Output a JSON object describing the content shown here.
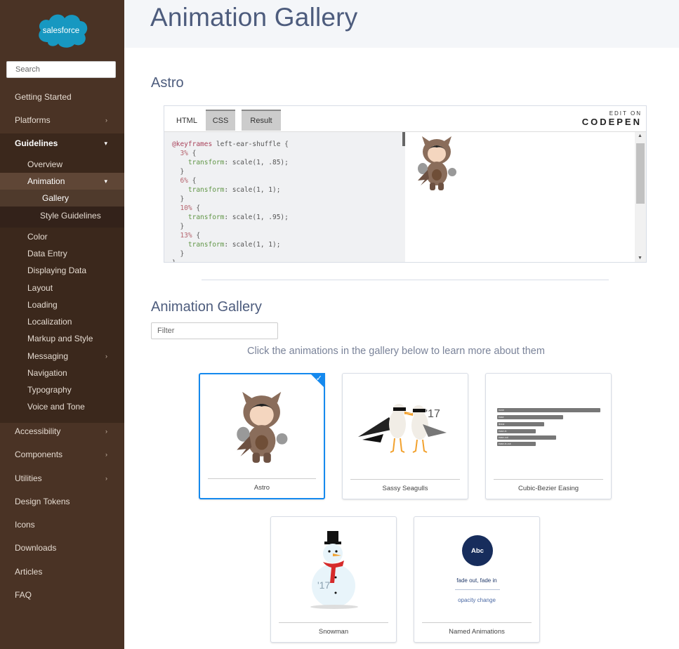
{
  "sidebar": {
    "logo_text": "salesforce",
    "search_placeholder": "Search",
    "items": [
      {
        "label": "Getting Started"
      },
      {
        "label": "Platforms",
        "chevron": "›"
      },
      {
        "label": "Guidelines",
        "chevron": "▾"
      },
      {
        "label": "Overview"
      },
      {
        "label": "Animation",
        "chevron": "▾"
      },
      {
        "label": "Gallery"
      },
      {
        "label": "Style Guidelines"
      },
      {
        "label": "Color"
      },
      {
        "label": "Data Entry"
      },
      {
        "label": "Displaying Data"
      },
      {
        "label": "Layout"
      },
      {
        "label": "Loading"
      },
      {
        "label": "Localization"
      },
      {
        "label": "Markup and Style"
      },
      {
        "label": "Messaging",
        "chevron": "›"
      },
      {
        "label": "Navigation"
      },
      {
        "label": "Typography"
      },
      {
        "label": "Voice and Tone"
      },
      {
        "label": "Accessibility",
        "chevron": "›"
      },
      {
        "label": "Components",
        "chevron": "›"
      },
      {
        "label": "Utilities",
        "chevron": "›"
      },
      {
        "label": "Design Tokens"
      },
      {
        "label": "Icons"
      },
      {
        "label": "Downloads"
      },
      {
        "label": "Articles"
      },
      {
        "label": "FAQ"
      }
    ]
  },
  "page": {
    "title": "Animation Gallery",
    "astro_heading": "Astro",
    "gallery_heading": "Animation Gallery",
    "filter_placeholder": "Filter",
    "hint": "Click the animations in the gallery below to learn more about them"
  },
  "codepen": {
    "tabs": [
      "HTML",
      "CSS",
      "Result"
    ],
    "brand_top": "EDIT ON",
    "brand_name": "CODEPEN",
    "code_lines": [
      {
        "kw": "@keyframes",
        "rest": " left-ear-shuffle {"
      },
      {
        "pct": "  3%",
        "rest": " {"
      },
      {
        "prop": "    transform",
        "rest": ": scale(1, .85);"
      },
      {
        "rest": "  }"
      },
      {
        "pct": "  6%",
        "rest": " {"
      },
      {
        "prop": "    transform",
        "rest": ": scale(1, 1);"
      },
      {
        "rest": "  }"
      },
      {
        "pct": "  10%",
        "rest": " {"
      },
      {
        "prop": "    transform",
        "rest": ": scale(1, .95);"
      },
      {
        "rest": "  }"
      },
      {
        "pct": "  13%",
        "rest": " {"
      },
      {
        "prop": "    transform",
        "rest": ": scale(1, 1);"
      },
      {
        "rest": "  }"
      },
      {
        "rest": "}"
      }
    ]
  },
  "cards": [
    {
      "label": "Astro",
      "selected": true
    },
    {
      "label": "Sassy Seagulls",
      "badge": "'17"
    },
    {
      "label": "Cubic-Bezier Easing",
      "bars": [
        "none",
        "ease",
        "linear",
        "ease-in",
        "ease-out",
        "ease-in-out"
      ]
    },
    {
      "label": "Snowman",
      "badge": "'17"
    },
    {
      "label": "Named Animations",
      "circle_text": "Abc",
      "line1": "fade out, fade in",
      "line2": "opacity change"
    }
  ],
  "colors": {
    "sidebar_bg": "#4a3325",
    "accent": "#1589ee",
    "heading": "#4d5c7d",
    "brand_blue": "#1798c1"
  }
}
